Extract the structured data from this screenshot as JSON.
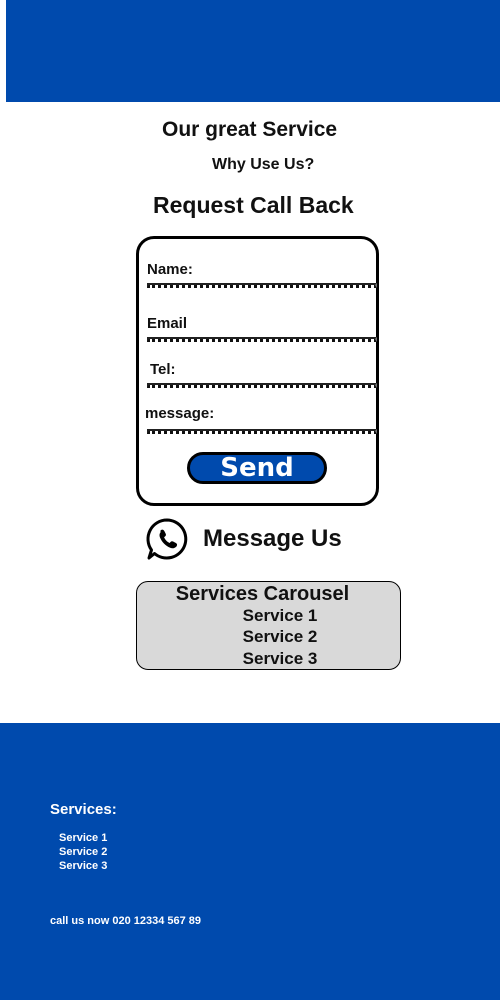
{
  "header": {
    "title": "Our great Service",
    "subtitle": "Why Use Us?"
  },
  "form": {
    "heading": "Request Call Back",
    "name_label": "Name:",
    "email_label": "Email",
    "tel_label": "Tel:",
    "message_label": "message:",
    "send_label": "Send"
  },
  "message_us": {
    "label": "Message Us",
    "icon": "whatsapp-icon"
  },
  "carousel": {
    "title": "Services Carousel",
    "items": [
      "Service 1",
      "Service 2",
      "Service 3"
    ]
  },
  "footer": {
    "services_heading": "Services:",
    "services": [
      "Service 1",
      "Service 2",
      "Service 3"
    ],
    "call_text": "call us now 020 12334 567 89"
  },
  "colors": {
    "brand_blue": "#004aad",
    "carousel_bg": "#d9d9d9"
  }
}
